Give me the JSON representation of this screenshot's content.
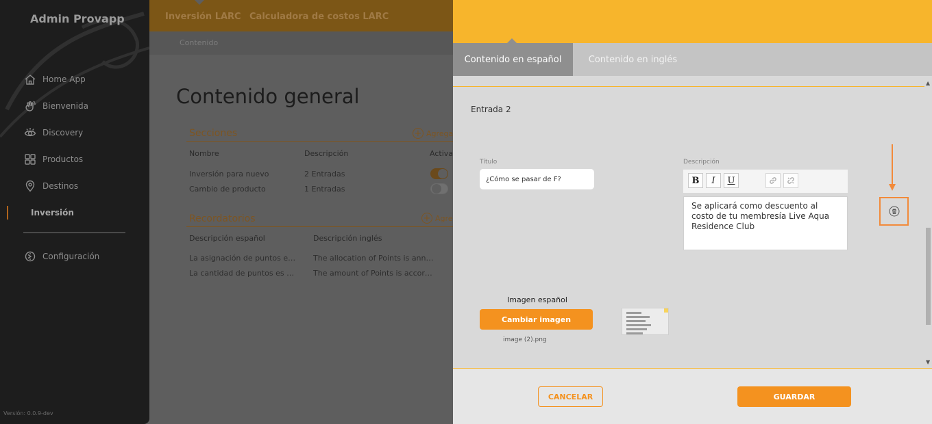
{
  "sidebar": {
    "brand": "Admin Provapp",
    "items": [
      {
        "label": "Home App",
        "icon": "home-icon"
      },
      {
        "label": "Bienvenida",
        "icon": "waving-hand-icon"
      },
      {
        "label": "Discovery",
        "icon": "eye-icon"
      },
      {
        "label": "Productos",
        "icon": "grid-icon"
      },
      {
        "label": "Destinos",
        "icon": "location-pin-icon"
      },
      {
        "label": "Inversión",
        "icon": "",
        "active": true
      }
    ],
    "settings": {
      "label": "Configuración",
      "icon": "settings-icon"
    },
    "version": "Versión: 0.0.9-dev"
  },
  "topbar": {
    "tabs": [
      "Inversión LARC",
      "Calculadora de costos LARC"
    ]
  },
  "breadcrumb": "Contenido",
  "main": {
    "page_title": "Contenido general",
    "sections": {
      "title": "Secciones",
      "add_label": "Agregar",
      "headers": [
        "Nombre",
        "Descripción",
        "Activar"
      ],
      "rows": [
        {
          "name": "Inversión para nuevo",
          "description": "2 Entradas",
          "active": true
        },
        {
          "name": "Cambio de producto",
          "description": "1 Entradas",
          "active": false
        }
      ]
    },
    "reminders": {
      "title": "Recordatorios",
      "add_label": "Agregar",
      "headers": [
        "Descripción español",
        "Descripción inglés"
      ],
      "rows": [
        {
          "es": "La asignación de puntos es anual",
          "en": "The allocation of Points is annual and"
        },
        {
          "es": "La cantidad de puntos es de acuerdo",
          "en": "The amount of Points is according to"
        }
      ]
    }
  },
  "modal": {
    "colors": {
      "header": "#f7b52c",
      "accent": "#f4921f",
      "annotation": "#f28a3a"
    },
    "tabs": [
      {
        "label": "Contenido en español",
        "active": true
      },
      {
        "label": "Contenido en inglés",
        "active": false
      }
    ],
    "entry": {
      "title": "Entrada 2",
      "title_label": "Título",
      "title_value": "¿Cómo se pasar de F?",
      "description_label": "Descripción",
      "toolbar": {
        "bold": "B",
        "italic": "I",
        "underline": "U"
      },
      "description_text": "Se aplicará como descuento al costo de tu membresía Live Aqua Residence Club",
      "image_label": "Imagen español",
      "change_image_label": "Cambiar imagen",
      "file_name": "image (2).png"
    },
    "footer": {
      "cancel_label": "CANCELAR",
      "save_label": "GUARDAR"
    }
  }
}
